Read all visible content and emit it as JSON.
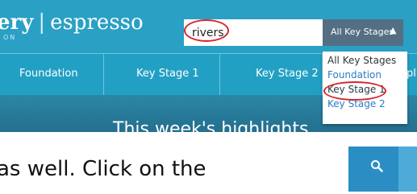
{
  "header": {
    "brand_left": "ery",
    "brand_separator": "|",
    "brand_right": "espresso",
    "brand_sub": "ON",
    "search_value": "rivers",
    "stage_select_label": "All Key Stages",
    "stage_select_chevron": "^"
  },
  "nav": {
    "items": [
      {
        "label": "Foundation"
      },
      {
        "label": "Key Stage 1"
      },
      {
        "label": "Key Stage 2"
      },
      {
        "label": "pl"
      }
    ]
  },
  "dropdown": {
    "items": [
      {
        "label": "All Key Stages"
      },
      {
        "label": "Foundation"
      },
      {
        "label": "Key Stage 1"
      },
      {
        "label": "Key Stage 2"
      }
    ]
  },
  "banner": {
    "title": "This week's highlights"
  },
  "caption": {
    "text": "as well. Click on the"
  },
  "search_button": {
    "icon": "search-icon"
  },
  "colors": {
    "accent": "#2aa0c5",
    "select_bg": "#546f83",
    "highlight_ring": "#d8262e",
    "link_blue": "#2a7cc7"
  }
}
